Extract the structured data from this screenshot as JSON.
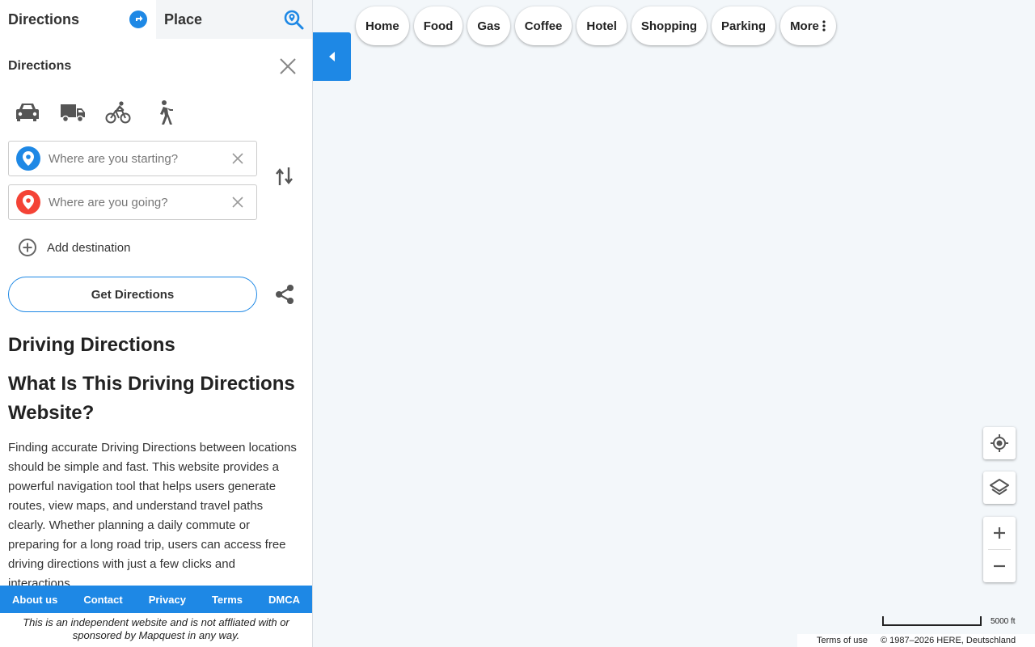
{
  "tabs": {
    "directions": "Directions",
    "place": "Place"
  },
  "panel": {
    "title": "Directions"
  },
  "modes": [
    "car-icon",
    "truck-icon",
    "bicycle-icon",
    "walking-icon"
  ],
  "inputs": {
    "start_placeholder": "Where are you starting?",
    "destination_placeholder": "Where are you going?",
    "start_value": "",
    "destination_value": ""
  },
  "add_destination": "Add destination",
  "get_directions": "Get Directions",
  "article": {
    "heading": "Driving Directions",
    "subheading": "What Is This Driving Directions Website?",
    "body": "Finding accurate Driving Directions between locations should be simple and fast. This website provides a powerful navigation tool that helps users generate routes, view maps, and understand travel paths clearly. Whether planning a daily commute or preparing for a long road trip, users can access free driving directions with just a few clicks and interactions."
  },
  "footer": {
    "links": [
      "About us",
      "Contact",
      "Privacy",
      "Terms",
      "DMCA"
    ],
    "disclaimer": "This is an independent website and is not affliated with or sponsored by Mapquest in any way."
  },
  "categories": [
    "Home",
    "Food",
    "Gas",
    "Coffee",
    "Hotel",
    "Shopping",
    "Parking",
    "More"
  ],
  "map": {
    "scale_label": "5000 ft",
    "terms": "Terms of use",
    "copyright": "© 1987–2026 HERE, Deutschland"
  },
  "colors": {
    "accent": "#1e88e5",
    "start_pin": "#1e88e5",
    "end_pin": "#f44336",
    "icon": "#555555",
    "map_bg": "#f3f7fa"
  }
}
